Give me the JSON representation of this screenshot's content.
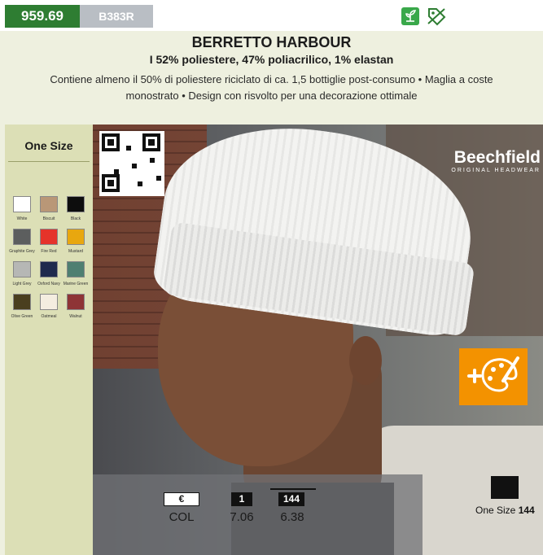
{
  "header": {
    "code": "959.69",
    "sku": "B383R",
    "title": "BERRETTO HARBOUR",
    "composition": "I 52% poliestere, 47% poliacrilico, 1% elastan",
    "description": "Contiene almeno il 50% di poliestere riciclato di ca. 1,5 bottiglie post-consumo • Maglia a coste monostrato • Design con risvolto per una decorazione ottimale"
  },
  "icons": {
    "eco": "sprout-icon",
    "recycle": "recycle-tag-icon",
    "decoration": "palette-plus-icon"
  },
  "sidebar": {
    "size_label": "One Size",
    "colors": [
      {
        "name": "White",
        "hex": "#ffffff"
      },
      {
        "name": "Biscuit",
        "hex": "#b99777"
      },
      {
        "name": "Black",
        "hex": "#0d0d0d"
      },
      {
        "name": "Graphite Grey",
        "hex": "#5c5e5e"
      },
      {
        "name": "Fire Red",
        "hex": "#e5332a"
      },
      {
        "name": "Mustard",
        "hex": "#e8a70f"
      },
      {
        "name": "Light Grey",
        "hex": "#b6b7b5"
      },
      {
        "name": "Oxford Navy",
        "hex": "#1f2a4d"
      },
      {
        "name": "Marine Green",
        "hex": "#4f7f71"
      },
      {
        "name": "Olive Green",
        "hex": "#4a3f1f"
      },
      {
        "name": "Oatmeal",
        "hex": "#f4ede0"
      },
      {
        "name": "Walnut",
        "hex": "#8e3436"
      }
    ]
  },
  "brand": {
    "name": "Beechfield",
    "tagline": "ORIGINAL HEADWEAR"
  },
  "pricing": {
    "currency": "€",
    "col_label": "COL",
    "tiers": [
      {
        "qty": "1",
        "price": "7.06"
      },
      {
        "qty": "144",
        "price": "6.38"
      }
    ]
  },
  "packaging": {
    "size": "One Size",
    "carton_qty": "144"
  },
  "colors": {
    "brand_green": "#2e7d32",
    "sku_grey": "#b9bec4",
    "header_bg": "#eef0df",
    "sidebar_bg": "#dcdfb6",
    "decoration_orange": "#f39200"
  }
}
